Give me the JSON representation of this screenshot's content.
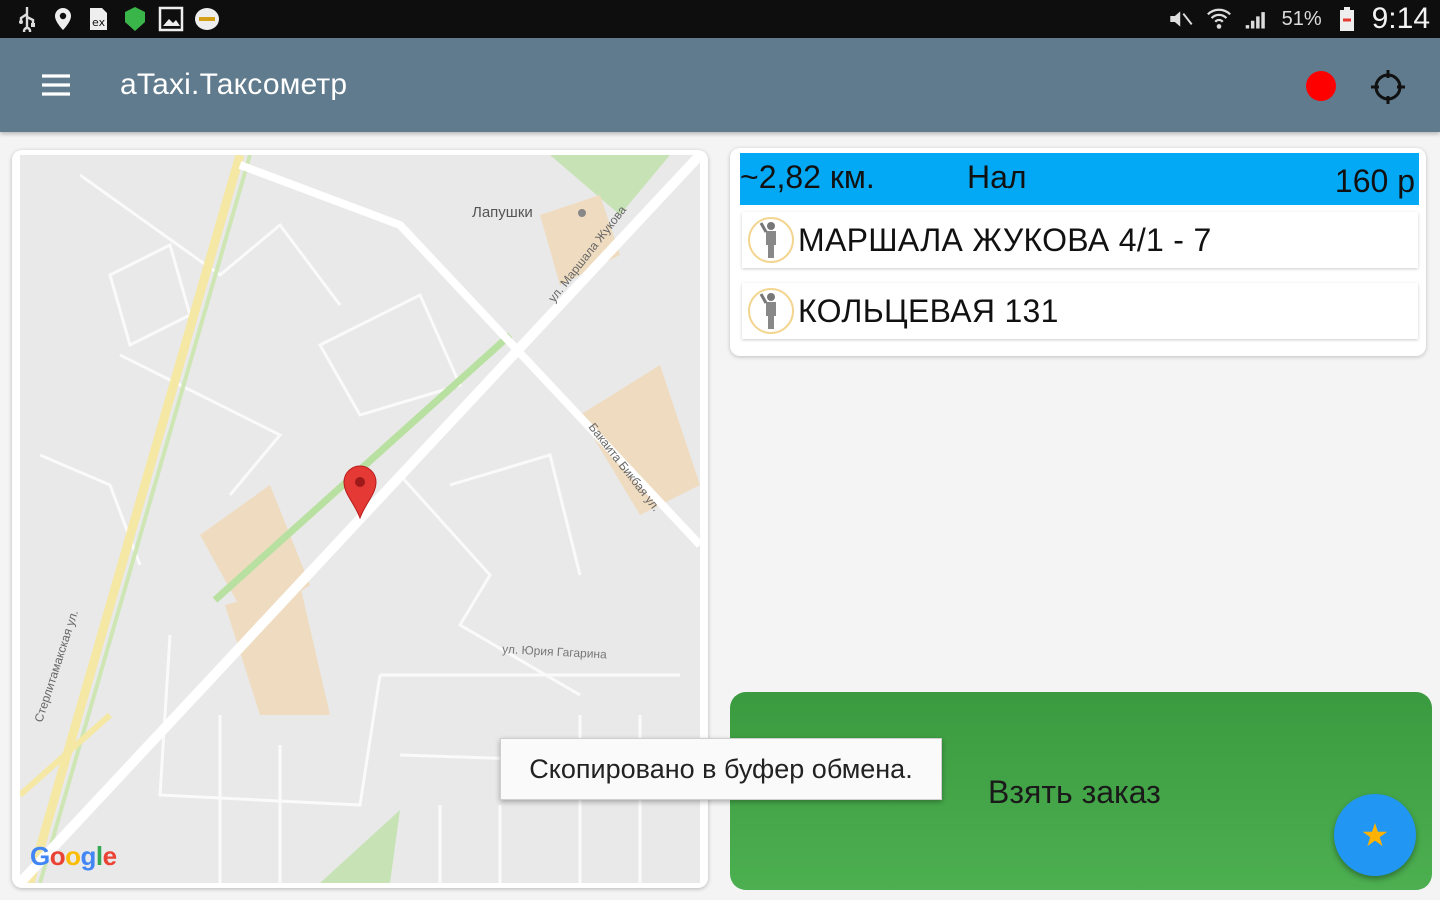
{
  "status_bar": {
    "icons_left": [
      "usb-icon",
      "location-icon",
      "document-icon",
      "shield-app-icon",
      "image-icon",
      "ataxi-app-icon"
    ],
    "icons_right": [
      "mute-icon",
      "wifi-icon",
      "signal-icon",
      "battery-icon"
    ],
    "battery": "51%",
    "time": "9:14"
  },
  "app_bar": {
    "title": "aTaxi.Таксометр",
    "menu_icon": "hamburger-icon",
    "record_indicator_color": "#ff0000",
    "gps_icon": "crosshair-icon"
  },
  "map": {
    "labels": {
      "lapushki": "Лапушки",
      "marshala": "ул. Маршала Жукова",
      "bagauova": "Бакаита Бикбая ул.",
      "gagarin": "ул. Юрия Гагарина",
      "sterlitamak": "Стерлитамакская ул."
    },
    "logo": [
      "G",
      "o",
      "o",
      "g",
      "l",
      "e"
    ]
  },
  "order": {
    "distance": "~2,82 км.",
    "payment": "Нал",
    "price": "160 р",
    "addresses": [
      "МАРШАЛА ЖУКОВА 4/1 - 7",
      "КОЛЬЦЕВАЯ 131"
    ],
    "header_color": "#03a9f4"
  },
  "take_order": {
    "label": "Взять заказ",
    "fab_icon": "star-icon"
  },
  "toast": {
    "text": "Скопировано в буфер обмена."
  }
}
